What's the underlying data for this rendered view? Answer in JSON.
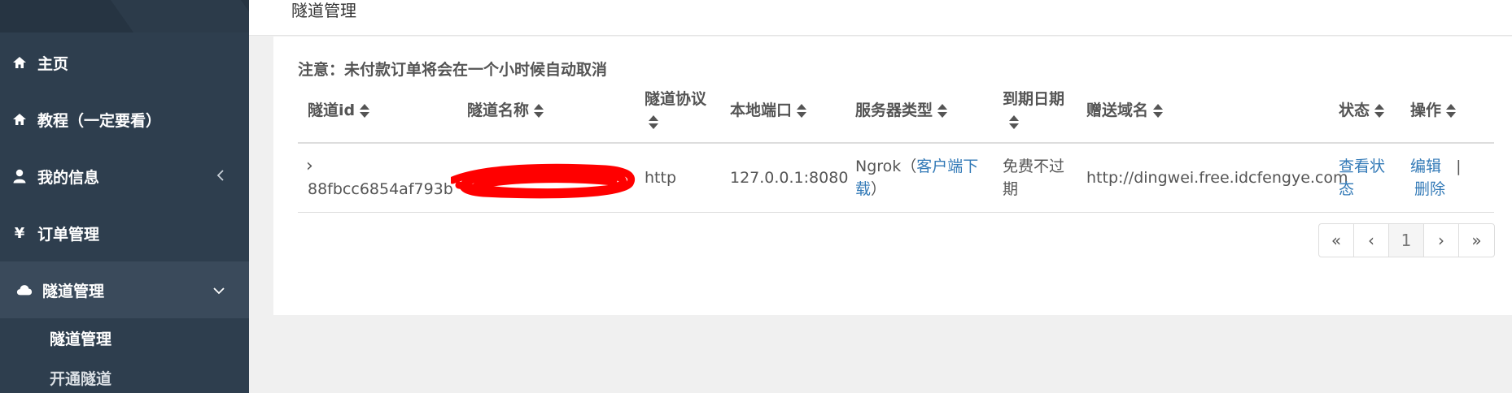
{
  "sidebar": {
    "items": [
      {
        "label": "主页",
        "icon": "home-icon"
      },
      {
        "label": "教程（一定要看）",
        "icon": "home-icon"
      },
      {
        "label": "我的信息",
        "icon": "user-icon"
      },
      {
        "label": "订单管理",
        "icon": "yen-icon"
      },
      {
        "label": "隧道管理",
        "icon": "cloud-icon"
      }
    ],
    "sub_items": [
      "隧道管理",
      "开通隧道"
    ],
    "yen_glyph": "¥"
  },
  "page": {
    "title": "隧道管理",
    "notice": "注意：未付款订单将会在一个小时候自动取消"
  },
  "table": {
    "headers": [
      "隧道id",
      "隧道名称",
      "隧道协议",
      "本地端口",
      "服务器类型",
      "到期日期",
      "赠送域名",
      "状态",
      "操作"
    ],
    "rows": [
      {
        "expand": "›",
        "id": "88fbcc6854af793b",
        "name": "",
        "protocol": "http",
        "local_port": "127.0.0.1:8080",
        "server_type_prefix": "Ngrok（",
        "server_type_link": "客户端下载",
        "server_type_suffix": "）",
        "expiry": "免费不过期",
        "domain": "http://dingwei.free.idcfengye.com",
        "status_link": "查看状态",
        "action_edit": "编辑",
        "action_sep": "|",
        "action_delete": "删除"
      }
    ]
  },
  "pagination": {
    "first": "«",
    "prev": "‹",
    "current": "1",
    "next": "›",
    "last": "»"
  },
  "colors": {
    "sidebar_bg": "#2e3e4e",
    "link": "#337ab7",
    "redaction": "#ff0000"
  }
}
